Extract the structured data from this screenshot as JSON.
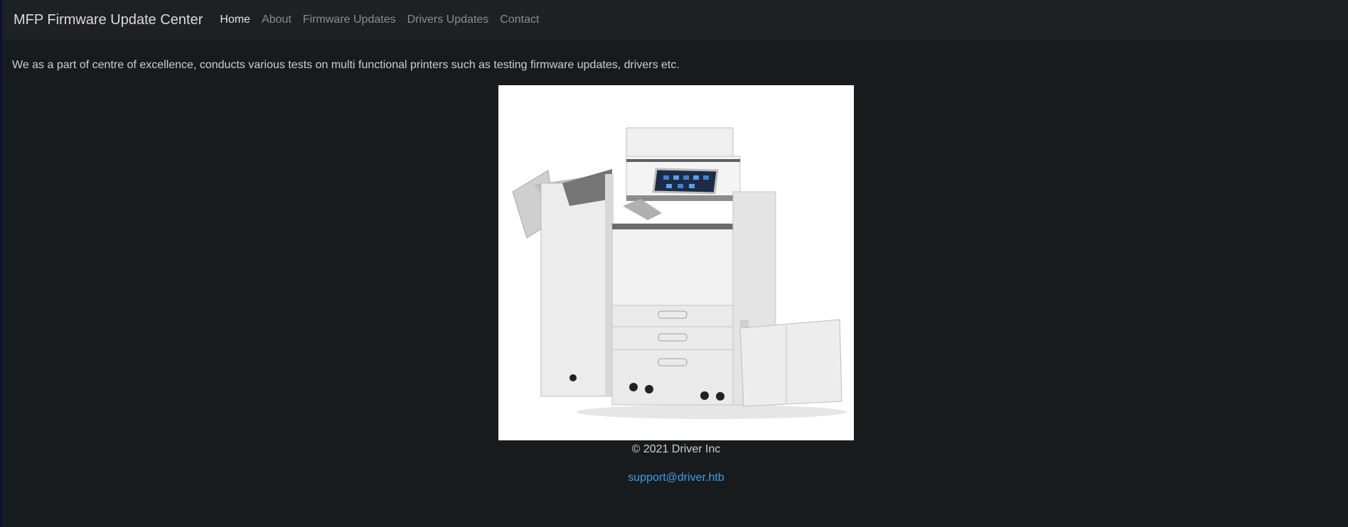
{
  "navbar": {
    "brand": "MFP Firmware Update Center",
    "links": [
      {
        "label": "Home",
        "active": true
      },
      {
        "label": "About",
        "active": false
      },
      {
        "label": "Firmware Updates",
        "active": false
      },
      {
        "label": "Drivers Updates",
        "active": false
      },
      {
        "label": "Contact",
        "active": false
      }
    ]
  },
  "main": {
    "intro": "We as a part of centre of excellence, conducts various tests on multi functional printers such as testing firmware updates, drivers etc.",
    "image_icon": "multifunction-printer-image"
  },
  "footer": {
    "copyright": "© 2021 Driver Inc",
    "support_email": "support@driver.htb"
  },
  "colors": {
    "background": "#181b1e",
    "navbar": "#1d2124",
    "link": "#3d9ee8"
  }
}
